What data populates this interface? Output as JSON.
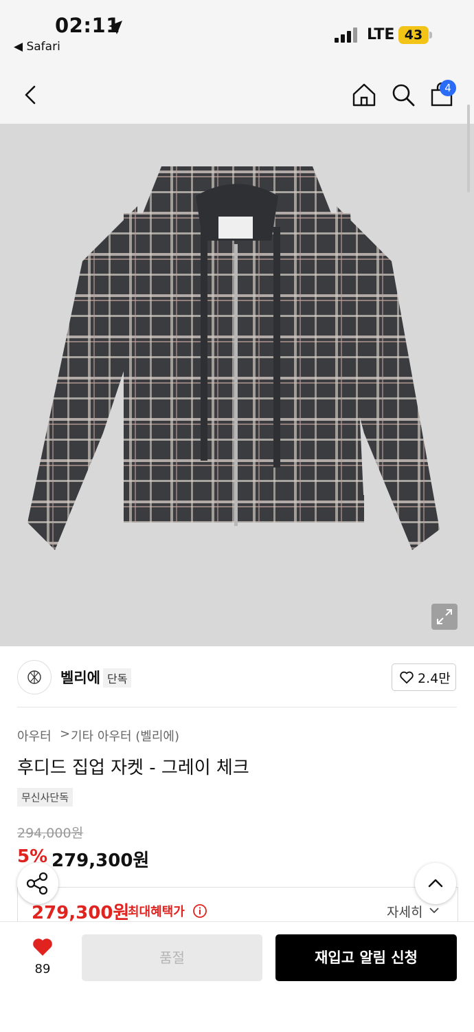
{
  "status_bar": {
    "time": "02:11",
    "back_app": "◀ Safari",
    "network": "LTE",
    "battery": "43"
  },
  "nav": {
    "cart_count": "4"
  },
  "brand": {
    "name": "벨리에",
    "exclusive_tag": "단독",
    "likes": "2.4만"
  },
  "breadcrumb": {
    "level1": "아우터",
    "separator": ">",
    "level2": "기타 아우터 (벨리에)"
  },
  "product": {
    "title": "후디드 집업 자켓 - 그레이 체크",
    "tag": "무신사단독",
    "original_price": "294,000원",
    "discount": "5%",
    "sale_price": "279,300원"
  },
  "benefit": {
    "max_price": "279,300원",
    "max_label": "최대혜택가",
    "detail_label": "자세히"
  },
  "bottom": {
    "fav_count": "89",
    "soldout_label": "품절",
    "restock_label": "재입고 알림 신청"
  },
  "colors": {
    "accent_red": "#e0231f",
    "badge_blue": "#2a6cf6",
    "primary_button": "#000000"
  }
}
